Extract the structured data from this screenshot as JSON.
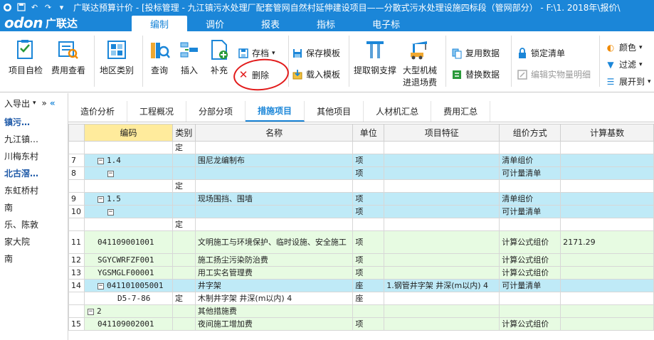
{
  "titlebar": {
    "title": "广联达预算计价 - [投标管理 - 九江镇污水处理厂配套管网自然村延伸建设项目——分散式污水处理设施四标段（管网部分） - F:\\1.   2018年\\报价\\",
    "icons": [
      "app-icon",
      "save-icon",
      "undo-icon",
      "redo-icon",
      "dropdown-icon"
    ]
  },
  "brand": {
    "en": "odon",
    "cn": "广联达"
  },
  "menu": {
    "tabs": [
      "编制",
      "调价",
      "报表",
      "指标",
      "电子标"
    ],
    "active_index": 0
  },
  "ribbon": {
    "project_check": "项目自检",
    "fee_view": "费用查看",
    "area_class": "地区类别",
    "query": "查询",
    "insert": "插入",
    "supplement": "补充",
    "archive": "存档",
    "delete": "删除",
    "save_template": "保存模板",
    "load_template": "载入模板",
    "extract_steel": "提取钢支撑",
    "machinery_line1": "大型机械",
    "machinery_line2": "进退场费",
    "reuse_data": "复用数据",
    "replace_data": "替换数据",
    "lock_list": "锁定清单",
    "edit_detail": "编辑实物量明细",
    "color": "颜色",
    "filter": "过滤",
    "expand_to": "展开到"
  },
  "leftpanel": {
    "import_export": "入导出",
    "items": [
      {
        "label": "镇污…",
        "style": "blue"
      },
      {
        "label": "九江镇…",
        "style": "normal"
      },
      {
        "label": "川梅东村",
        "style": "normal"
      },
      {
        "label": "北古滘…",
        "style": "blue"
      },
      {
        "label": "东虹桥村",
        "style": "normal"
      },
      {
        "label": "南",
        "style": "normal"
      },
      {
        "label": "乐、陈敦",
        "style": "normal"
      },
      {
        "label": "家大院",
        "style": "normal"
      },
      {
        "label": "南",
        "style": "normal"
      }
    ]
  },
  "subtabs": {
    "tabs": [
      "造价分析",
      "工程概况",
      "分部分项",
      "措施项目",
      "其他项目",
      "人材机汇总",
      "费用汇总"
    ],
    "active_index": 3
  },
  "grid": {
    "columns": [
      "",
      "编码",
      "类别",
      "名称",
      "单位",
      "项目特征",
      "组价方式",
      "计算基数"
    ],
    "rows": [
      {
        "num": "",
        "code": "",
        "cat": "定",
        "name": "",
        "unit": "",
        "feat": "",
        "method": "",
        "base": "",
        "style": "white",
        "expander": "",
        "indent": 0
      },
      {
        "num": "7",
        "code": "1.4",
        "cat": "",
        "name": "围尼龙编制布",
        "unit": "项",
        "feat": "",
        "method": "清单组价",
        "base": "",
        "style": "blue",
        "expander": "−",
        "indent": 1
      },
      {
        "num": "8",
        "code": "",
        "cat": "",
        "name": "",
        "unit": "项",
        "feat": "",
        "method": "可计量清单",
        "base": "",
        "style": "blue",
        "expander": "−",
        "indent": 2
      },
      {
        "num": "",
        "code": "",
        "cat": "定",
        "name": "",
        "unit": "",
        "feat": "",
        "method": "",
        "base": "",
        "style": "white",
        "expander": "",
        "indent": 0
      },
      {
        "num": "9",
        "code": "1.5",
        "cat": "",
        "name": "现场围挡、围墙",
        "unit": "项",
        "feat": "",
        "method": "清单组价",
        "base": "",
        "style": "blue",
        "expander": "−",
        "indent": 1
      },
      {
        "num": "10",
        "code": "",
        "cat": "",
        "name": "",
        "unit": "项",
        "feat": "",
        "method": "可计量清单",
        "base": "",
        "style": "blue",
        "expander": "−",
        "indent": 2
      },
      {
        "num": "",
        "code": "",
        "cat": "定",
        "name": "",
        "unit": "",
        "feat": "",
        "method": "",
        "base": "",
        "style": "white",
        "expander": "",
        "indent": 0
      },
      {
        "num": "11",
        "code": "041109001001",
        "cat": "",
        "name": "文明施工与环境保护、临时设施、安全施工",
        "unit": "项",
        "feat": "",
        "method": "计算公式组价",
        "base": "2171.29",
        "style": "green",
        "expander": "",
        "indent": 1,
        "tall": true
      },
      {
        "num": "12",
        "code": "SGYCWRFZF001",
        "cat": "",
        "name": "施工扬尘污染防治费",
        "unit": "项",
        "feat": "",
        "method": "计算公式组价",
        "base": "",
        "style": "green",
        "expander": "",
        "indent": 1
      },
      {
        "num": "13",
        "code": "YGSMGLF00001",
        "cat": "",
        "name": "用工实名管理费",
        "unit": "项",
        "feat": "",
        "method": "计算公式组价",
        "base": "",
        "style": "green",
        "expander": "",
        "indent": 1
      },
      {
        "num": "14",
        "code": "041101005001",
        "cat": "",
        "name": "井字架",
        "unit": "座",
        "feat": "1.钢管井字架 井深(m以内) 4",
        "method": "可计量清单",
        "base": "",
        "style": "blue",
        "expander": "−",
        "indent": 1
      },
      {
        "num": "",
        "code": "D5-7-86",
        "cat": "定",
        "name": "木制井字架 井深(m以内) 4",
        "unit": "座",
        "feat": "",
        "method": "",
        "base": "",
        "style": "white",
        "expander": "",
        "indent": 3
      },
      {
        "num": "",
        "code": "2",
        "cat": "",
        "name": "其他措施费",
        "unit": "",
        "feat": "",
        "method": "",
        "base": "",
        "style": "green",
        "expander": "−",
        "indent": 0
      },
      {
        "num": "15",
        "code": "041109002001",
        "cat": "",
        "name": "夜间施工增加费",
        "unit": "项",
        "feat": "",
        "method": "计算公式组价",
        "base": "",
        "style": "green",
        "expander": "",
        "indent": 1
      }
    ]
  },
  "colors": {
    "titlebar": "#1b86d8",
    "accent": "#1b86d8",
    "row_blue": "#bfeaf7",
    "row_green": "#e7fbe2",
    "header_code": "#ffeb9c",
    "circle": "#e21b1b"
  }
}
